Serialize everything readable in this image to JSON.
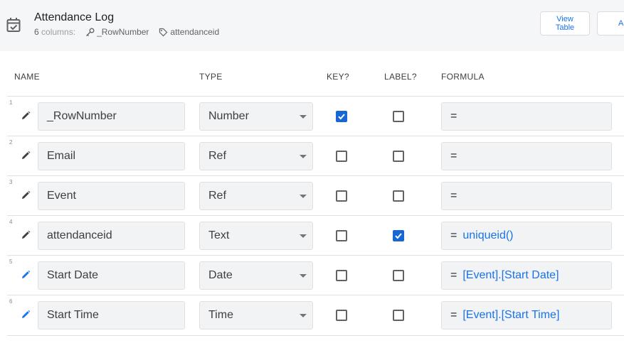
{
  "header": {
    "title": "Attendance Log",
    "column_count": "6",
    "columns_word": "columns:",
    "key_column": "_RowNumber",
    "label_column": "attendanceid",
    "view_table_line1": "View",
    "view_table_line2": "Table",
    "add_button_partial": "Ad"
  },
  "columns": {
    "name": "NAME",
    "type": "TYPE",
    "key": "KEY?",
    "label": "LABEL?",
    "formula": "FORMULA"
  },
  "rows": [
    {
      "num": "1",
      "name": "_RowNumber",
      "type": "Number",
      "key": true,
      "label": false,
      "eq": "=",
      "formula": "",
      "edited": false
    },
    {
      "num": "2",
      "name": "Email",
      "type": "Ref",
      "key": false,
      "label": false,
      "eq": "=",
      "formula": "",
      "edited": false
    },
    {
      "num": "3",
      "name": "Event",
      "type": "Ref",
      "key": false,
      "label": false,
      "eq": "=",
      "formula": "",
      "edited": false
    },
    {
      "num": "4",
      "name": "attendanceid",
      "type": "Text",
      "key": false,
      "label": true,
      "eq": "=",
      "formula": "uniqueid()",
      "edited": false
    },
    {
      "num": "5",
      "name": "Start Date",
      "type": "Date",
      "key": false,
      "label": false,
      "eq": "=",
      "formula": "[Event].[Start Date]",
      "edited": true
    },
    {
      "num": "6",
      "name": "Start Time",
      "type": "Time",
      "key": false,
      "label": false,
      "eq": "=",
      "formula": "[Event].[Start Time]",
      "edited": true
    }
  ],
  "colors": {
    "accent": "#1a73e8",
    "checkbox_checked": "#1967d2",
    "pencil_default": "#3c4043",
    "pencil_edited": "#1a73e8"
  }
}
